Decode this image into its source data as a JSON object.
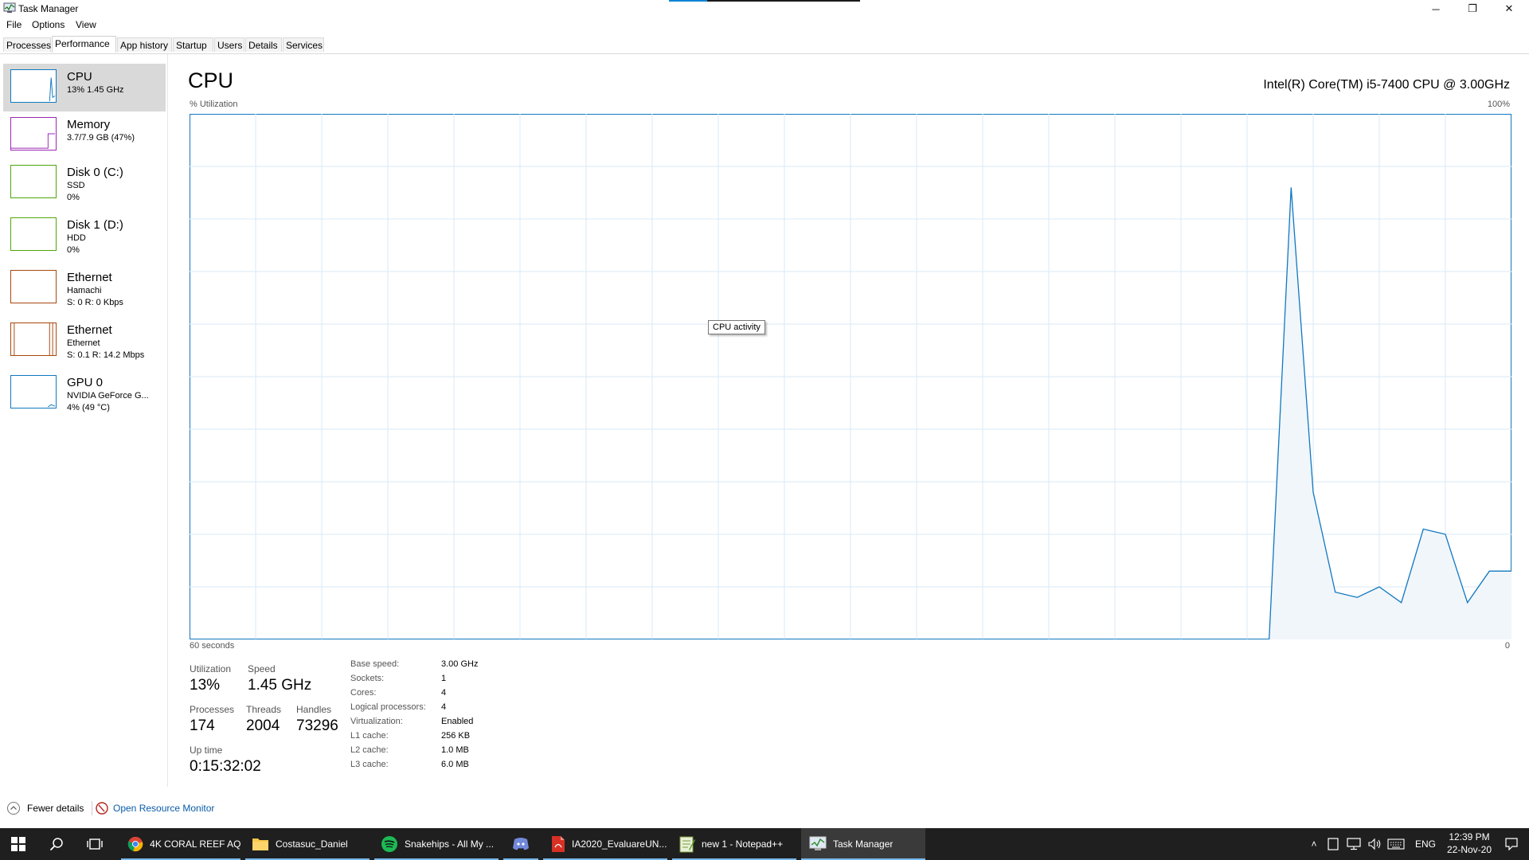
{
  "window": {
    "title": "Task Manager",
    "controls": {
      "minimize": "─",
      "restore": "❐",
      "close": "✕"
    }
  },
  "menu": [
    "File",
    "Options",
    "View"
  ],
  "tabs": [
    "Processes",
    "Performance",
    "App history",
    "Startup",
    "Users",
    "Details",
    "Services"
  ],
  "sidebar": [
    {
      "name": "CPU",
      "sub1": "13%  1.45 GHz",
      "sub2": "",
      "color": "#1178c0"
    },
    {
      "name": "Memory",
      "sub1": "3.7/7.9 GB (47%)",
      "sub2": "",
      "color": "#9a29b3"
    },
    {
      "name": "Disk 0 (C:)",
      "sub1": "SSD",
      "sub2": "0%",
      "color": "#4da60b"
    },
    {
      "name": "Disk 1 (D:)",
      "sub1": "HDD",
      "sub2": "0%",
      "color": "#4da60b"
    },
    {
      "name": "Ethernet",
      "sub1": "Hamachi",
      "sub2": "S: 0  R: 0 Kbps",
      "color": "#a7480f"
    },
    {
      "name": "Ethernet",
      "sub1": "Ethernet",
      "sub2": "S: 0.1  R: 14.2 Mbps",
      "color": "#a7480f"
    },
    {
      "name": "GPU 0",
      "sub1": "NVIDIA GeForce G...",
      "sub2": "4% (49 °C)",
      "color": "#1178c0"
    }
  ],
  "main": {
    "title": "CPU",
    "model": "Intel(R) Core(TM) i5-7400 CPU @ 3.00GHz",
    "util_label": "% Utilization",
    "max_label": "100%",
    "seconds_label": "60 seconds",
    "zero_label": "0",
    "tooltip": "CPU activity"
  },
  "chart_data": {
    "type": "area",
    "x": [
      0,
      49,
      50,
      51,
      52,
      53,
      54,
      55,
      56,
      57,
      58,
      59,
      60
    ],
    "values": [
      0,
      0,
      86,
      28,
      9,
      8,
      10,
      7,
      21,
      20,
      7,
      13,
      13
    ],
    "ylim": [
      0,
      100
    ],
    "xlim": [
      0,
      60
    ],
    "grid": true,
    "line_color": "#1178c0",
    "fill_color": "#f1f6fb"
  },
  "stats": {
    "utilization": {
      "label": "Utilization",
      "value": "13%"
    },
    "speed": {
      "label": "Speed",
      "value": "1.45 GHz"
    },
    "processes": {
      "label": "Processes",
      "value": "174"
    },
    "threads": {
      "label": "Threads",
      "value": "2004"
    },
    "handles": {
      "label": "Handles",
      "value": "73296"
    },
    "uptime": {
      "label": "Up time",
      "value": "0:15:32:02"
    }
  },
  "specs": [
    {
      "label": "Base speed:",
      "value": "3.00 GHz"
    },
    {
      "label": "Sockets:",
      "value": "1"
    },
    {
      "label": "Cores:",
      "value": "4"
    },
    {
      "label": "Logical processors:",
      "value": "4"
    },
    {
      "label": "Virtualization:",
      "value": "Enabled"
    },
    {
      "label": "L1 cache:",
      "value": "256 KB"
    },
    {
      "label": "L2 cache:",
      "value": "1.0 MB"
    },
    {
      "label": "L3 cache:",
      "value": "6.0 MB"
    }
  ],
  "footer": {
    "fewer": "Fewer details",
    "resource": "Open Resource Monitor"
  },
  "taskbar": {
    "apps": [
      {
        "label": "4K CORAL REEF AQ...",
        "icon": "chrome-icon"
      },
      {
        "label": "Costasuc_Daniel",
        "icon": "folder-icon"
      },
      {
        "label": "Snakehips - All My ...",
        "icon": "spotify-icon"
      },
      {
        "label": "",
        "icon": "discord-icon"
      },
      {
        "label": "IA2020_EvaluareUN...",
        "icon": "pdf-icon"
      },
      {
        "label": "new 1 - Notepad++",
        "icon": "notepad-icon"
      },
      {
        "label": "Task Manager",
        "icon": "task-manager-icon"
      }
    ],
    "lang": "ENG",
    "time": "12:39 PM",
    "date": "22-Nov-20"
  }
}
